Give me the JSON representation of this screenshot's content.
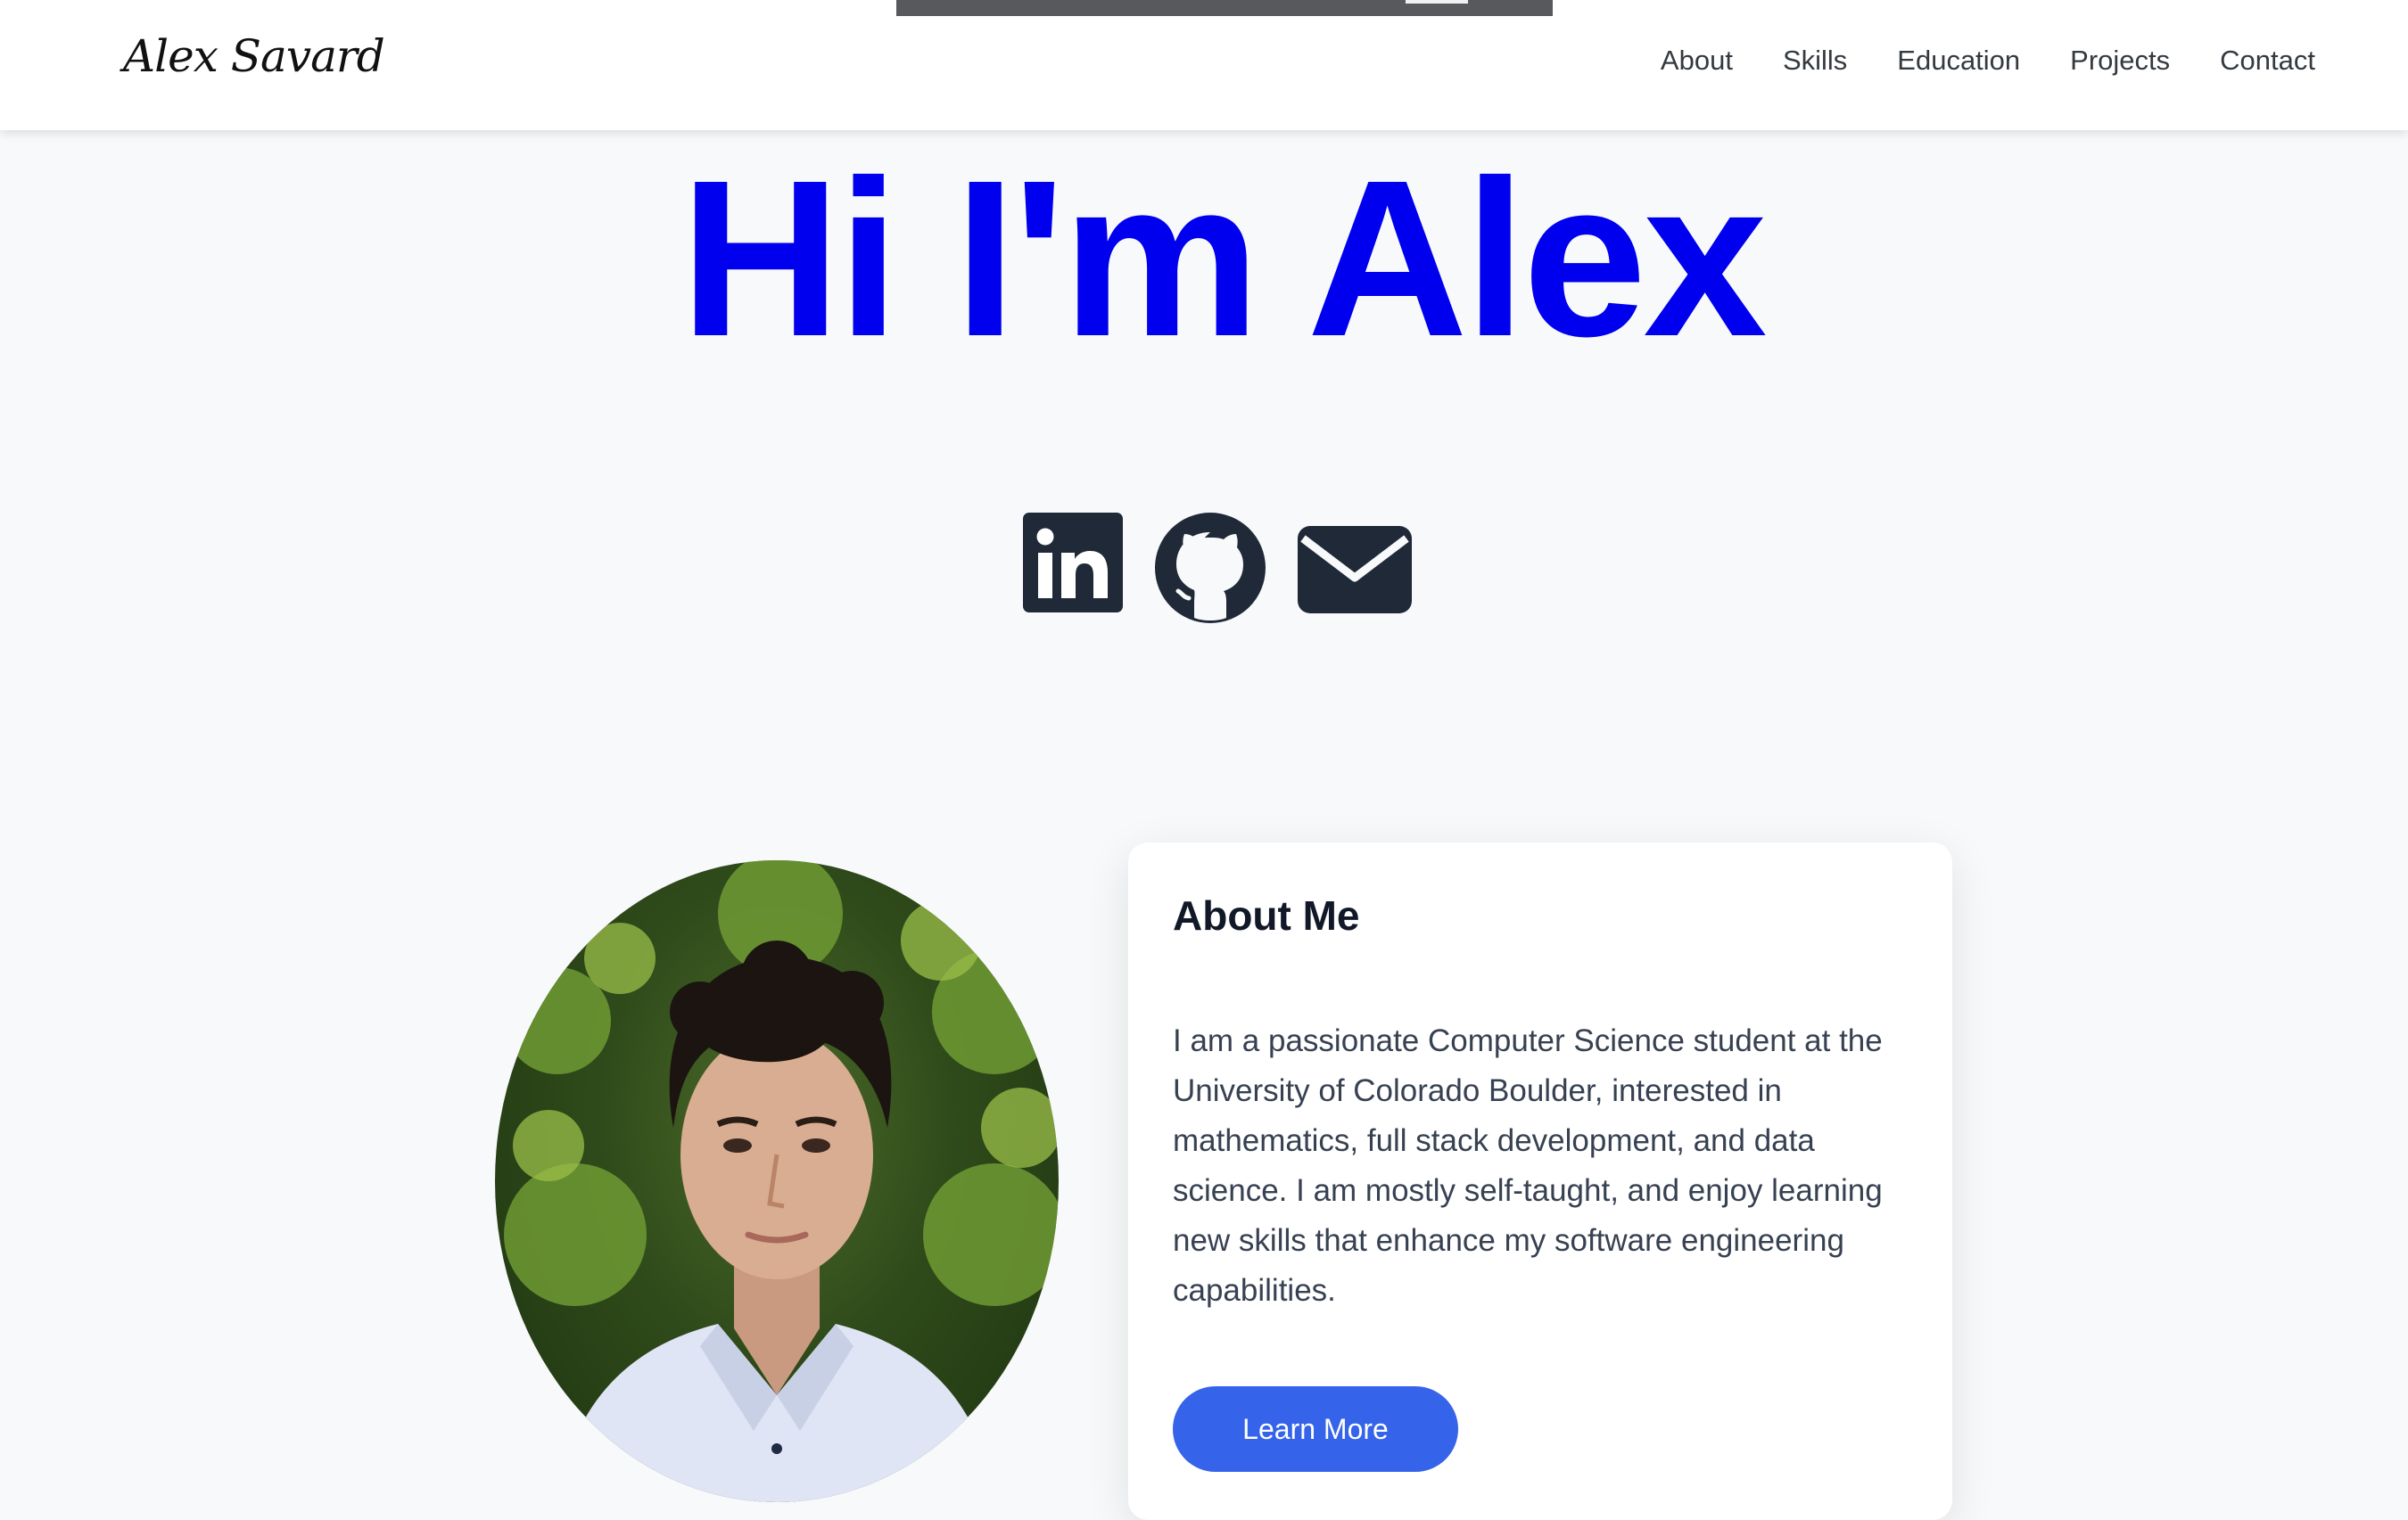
{
  "nav": {
    "brand": "Alex Savard",
    "links": [
      "About",
      "Skills",
      "Education",
      "Projects",
      "Contact"
    ]
  },
  "hero": {
    "title": "Hi I'm Alex"
  },
  "socials": {
    "linkedin": "linkedin-icon",
    "github": "github-icon",
    "email": "envelope-icon"
  },
  "about": {
    "title": "About Me",
    "body": "I am a passionate Computer Science student at the University of Colorado Boulder, interested in mathematics, full stack development, and data science. I am mostly self-taught, and enjoy learning new skills that enhance my software engineering capabilities.",
    "button": "Learn More"
  },
  "colors": {
    "hero": "#0000ee",
    "icons": "#1f2937",
    "button": "#3563e9"
  }
}
